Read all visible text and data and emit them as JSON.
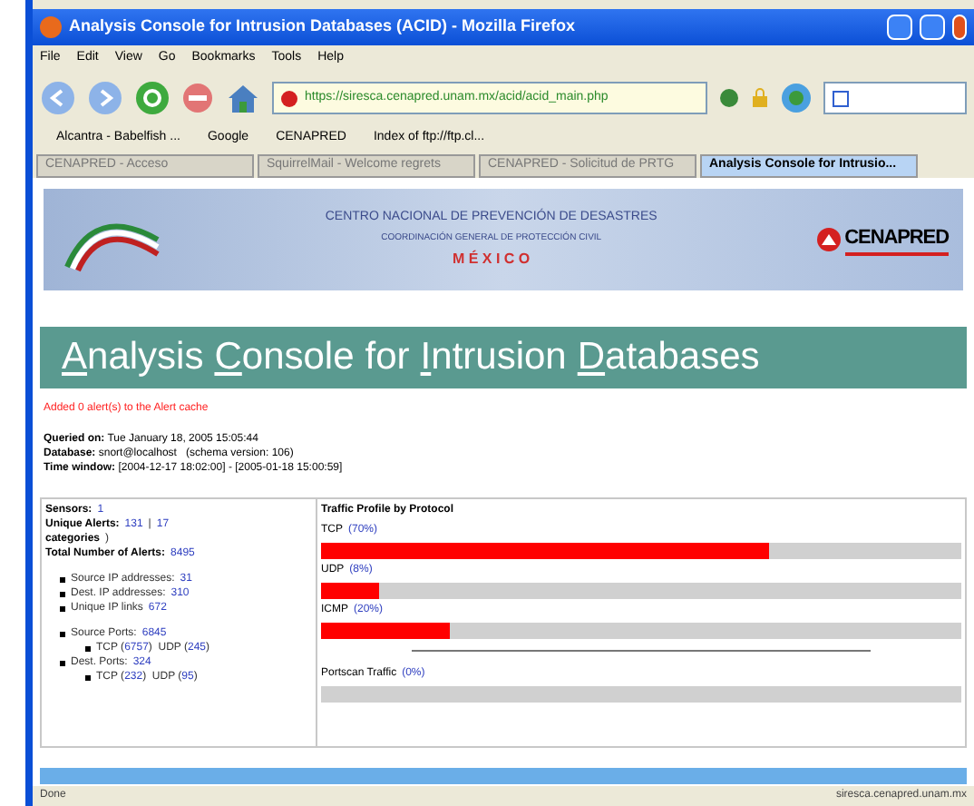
{
  "window": {
    "title": "Analysis Console for Intrusion Databases (ACID) - Mozilla Firefox"
  },
  "menu": [
    "File",
    "Edit",
    "View",
    "Go",
    "Bookmarks",
    "Tools",
    "Help"
  ],
  "address_bar": {
    "value": "https://siresca.cenapred.unam.mx/acid/acid_main.php"
  },
  "bookmarks": [
    "Alcantra - Babelfish ...",
    "Google",
    "CENAPRED",
    "Index of ftp://ftp.cl..."
  ],
  "tabs": [
    {
      "label": "CENAPRED - Acceso",
      "selected": false
    },
    {
      "label": "SquirrelMail - Welcome regrets",
      "selected": false
    },
    {
      "label": "CENAPRED - Solicitud de PRTG",
      "selected": false
    },
    {
      "label": "Analysis Console for Intrusio...",
      "selected": true
    }
  ],
  "banner": {
    "line_1": "CENTRO NACIONAL DE PREVENCIÓN DE DESASTRES",
    "line_2": "COORDINACIÓN GENERAL DE PROTECCIÓN CIVIL",
    "line_3": "M É X I C O",
    "logo": "CENAPRED"
  },
  "title_words": [
    {
      "text": "Analysis",
      "underline_initial": true
    },
    {
      "text": "Console",
      "underline_initial": true
    },
    {
      "text": "for",
      "underline_initial": false
    },
    {
      "text": "Intrusion",
      "underline_initial": true
    },
    {
      "text": "Databases",
      "underline_initial": true
    }
  ],
  "message": "Added 0 alert(s) to the Alert cache",
  "query_info": [
    {
      "label": "Queried on:",
      "value": "Tue January 18, 2005 15:05:44"
    },
    {
      "label": "Database:",
      "value": "snort@localhost   (schema version: 106)"
    },
    {
      "label": "Time window:",
      "value": "[2004-12-17 18:02:00] - [2005-01-18 15:00:59]"
    }
  ],
  "summary": [
    {
      "parts": [
        {
          "kind": "label",
          "text": "Sensors:"
        },
        {
          "kind": "link",
          "text": "1"
        }
      ]
    },
    {
      "parts": [
        {
          "kind": "label",
          "text": "Unique Alerts:"
        },
        {
          "kind": "link",
          "text": "131"
        },
        {
          "kind": "text",
          "text": "|"
        },
        {
          "kind": "link",
          "text": "17"
        }
      ]
    },
    {
      "parts": [
        {
          "kind": "label",
          "text": "categories"
        },
        {
          "kind": "text",
          "text": ")"
        }
      ]
    },
    {
      "parts": [
        {
          "kind": "label",
          "text": "Total Number of Alerts:"
        },
        {
          "kind": "link",
          "text": "8495"
        }
      ]
    }
  ],
  "bullet_groups": [
    {
      "items": [
        {
          "parts": [
            {
              "kind": "text",
              "text": "Source IP addresses:"
            },
            {
              "kind": "link",
              "text": "31"
            }
          ]
        },
        {
          "parts": [
            {
              "kind": "text",
              "text": "Dest. IP addresses:"
            },
            {
              "kind": "link",
              "text": "310"
            }
          ]
        },
        {
          "parts": [
            {
              "kind": "text",
              "text": "Unique IP links"
            },
            {
              "kind": "link",
              "text": "672"
            }
          ]
        }
      ]
    },
    {
      "items": [
        {
          "parts": [
            {
              "kind": "text",
              "text": "Source Ports:"
            },
            {
              "kind": "link",
              "text": "6845"
            }
          ],
          "children": [
            {
              "parts": [
                {
                  "kind": "text",
                  "text": "TCP ("
                },
                {
                  "kind": "link",
                  "text": "6757"
                },
                {
                  "kind": "text",
                  "text": ")  UDP ("
                },
                {
                  "kind": "link",
                  "text": "245"
                },
                {
                  "kind": "text",
                  "text": ")"
                }
              ]
            }
          ]
        },
        {
          "parts": [
            {
              "kind": "text",
              "text": "Dest. Ports:"
            },
            {
              "kind": "link",
              "text": "324"
            }
          ],
          "children": [
            {
              "parts": [
                {
                  "kind": "text",
                  "text": "TCP ("
                },
                {
                  "kind": "link",
                  "text": "232"
                },
                {
                  "kind": "text",
                  "text": ")  UDP ("
                },
                {
                  "kind": "link",
                  "text": "95"
                },
                {
                  "kind": "text",
                  "text": ")"
                }
              ]
            }
          ]
        }
      ]
    }
  ],
  "traffic": {
    "title": "Traffic Profile by Protocol",
    "protocols": [
      {
        "kind": "protocol",
        "name": "TCP",
        "percent": "(70%)",
        "level": 0.7
      },
      {
        "kind": "protocol",
        "name": "UDP",
        "percent": "(8%)",
        "level": 0.09
      },
      {
        "kind": "protocol",
        "name": "ICMP",
        "percent": "(20%)",
        "level": 0.2
      },
      {
        "kind": "portscan",
        "name": "Portscan Traffic",
        "percent": "(0%)",
        "level": 0
      }
    ]
  },
  "status_bar": {
    "text": "Done",
    "host": "siresca.cenapred.unam.mx"
  }
}
